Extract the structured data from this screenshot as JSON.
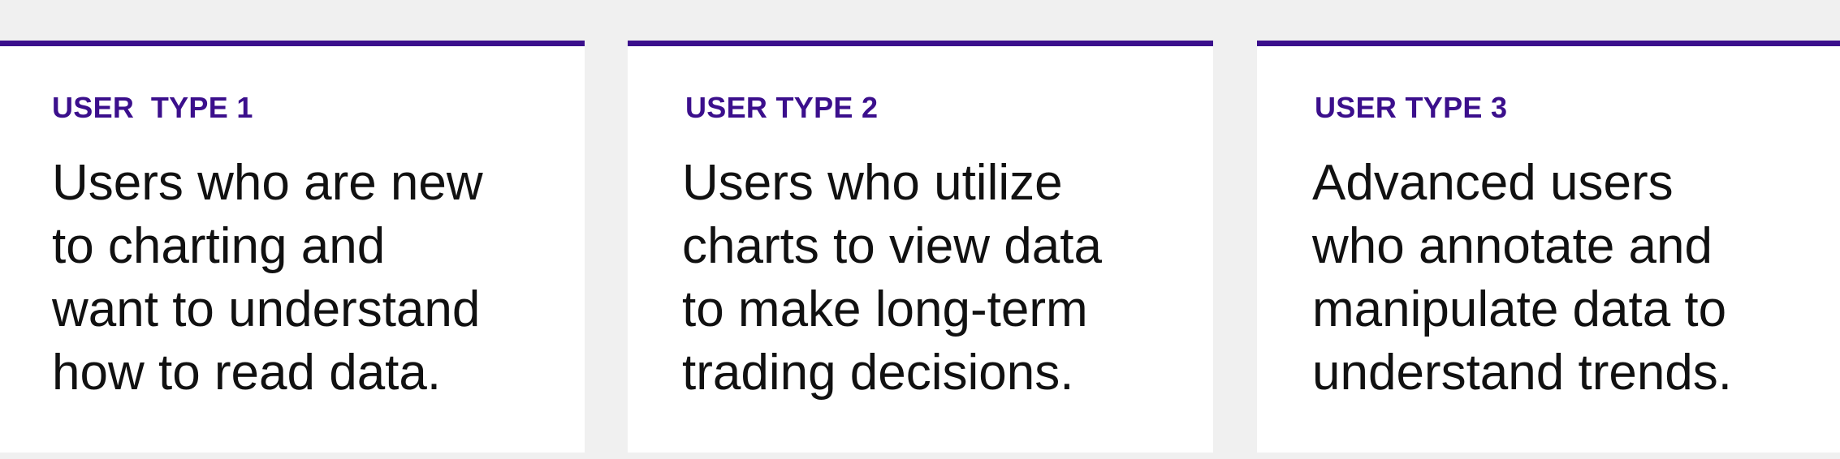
{
  "cards": [
    {
      "label": "USER  TYPE 1",
      "lines": [
        "Users who are new",
        "to charting and",
        "want to understand",
        "how to read data."
      ]
    },
    {
      "label": "USER TYPE 2",
      "lines": [
        "Users who utilize",
        "charts to view data",
        "to make long-term",
        "trading decisions."
      ]
    },
    {
      "label": "USER TYPE 3",
      "lines": [
        "Advanced users",
        "who annotate and",
        "manipulate data to",
        "understand trends."
      ]
    }
  ],
  "colors": {
    "accent": "#3b0f8c",
    "background": "#f0f0f0",
    "card": "#ffffff",
    "text": "#111111"
  }
}
